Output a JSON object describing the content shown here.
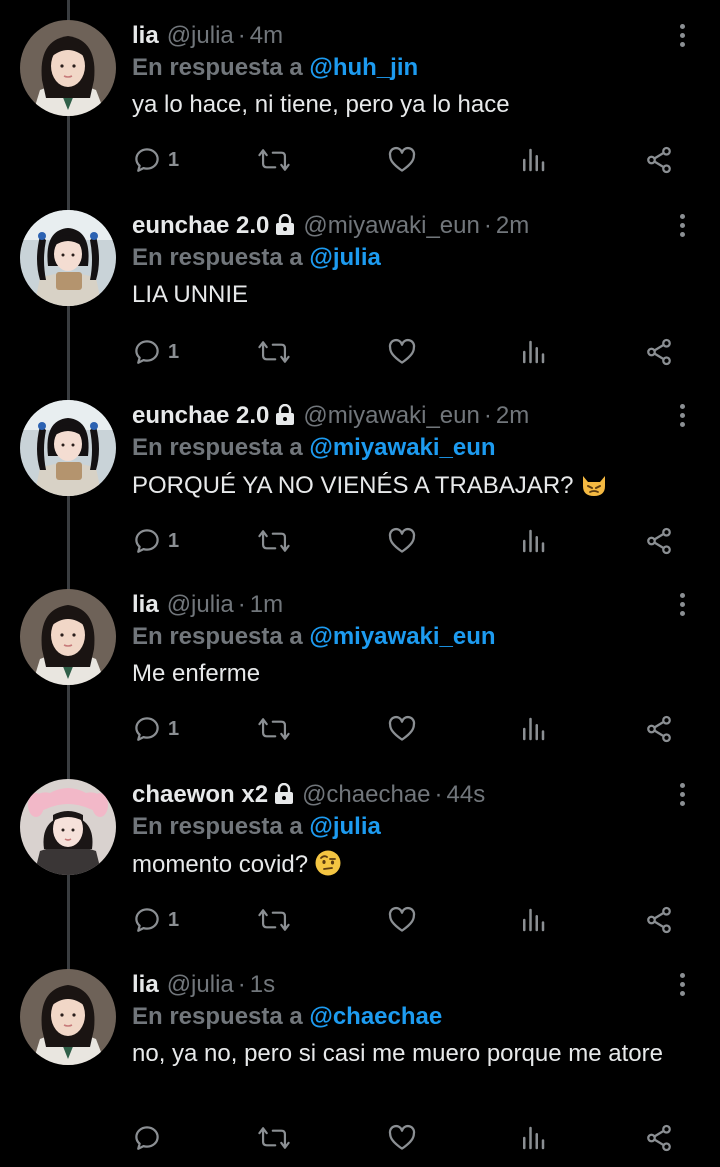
{
  "reply_prefix": "En respuesta a",
  "colors": {
    "background": "#000000",
    "text": "#e7e9ea",
    "muted": "#71767b",
    "mention": "#1d9bf0",
    "thread_line": "#3a3d40"
  },
  "tweets": [
    {
      "name": "lia",
      "handle": "@julia",
      "time": "4m",
      "locked": false,
      "reply_to": "@huh_jin",
      "text": "ya lo hace, ni tiene, pero ya lo hace",
      "emoji": "",
      "reply_count": "1",
      "avatar": "woman-in-school-uniform"
    },
    {
      "name": "eunchae 2.0",
      "handle": "@miyawaki_eun",
      "time": "2m",
      "locked": true,
      "reply_to": "@julia",
      "text": "LIA UNNIE",
      "emoji": "",
      "reply_count": "1",
      "avatar": "girl-with-pigtails-holding-cake"
    },
    {
      "name": "eunchae 2.0",
      "handle": "@miyawaki_eun",
      "time": "2m",
      "locked": true,
      "reply_to": "@miyawaki_eun",
      "text": "PORQUÉ YA NO VIENÉS A TRABAJAR?",
      "emoji": "pouting-cat",
      "reply_count": "1",
      "avatar": "girl-with-pigtails-holding-cake"
    },
    {
      "name": "lia",
      "handle": "@julia",
      "time": "1m",
      "locked": false,
      "reply_to": "@miyawaki_eun",
      "text": "Me enferme",
      "emoji": "",
      "reply_count": "1",
      "avatar": "woman-in-school-uniform"
    },
    {
      "name": "chaewon x2",
      "handle": "@chaechae",
      "time": "44s",
      "locked": true,
      "reply_to": "@julia",
      "text": "momento covid?",
      "emoji": "face-with-raised-eyebrow",
      "reply_count": "1",
      "avatar": "girl-in-pink-bunny-hat"
    },
    {
      "name": "lia",
      "handle": "@julia",
      "time": "1s",
      "locked": false,
      "reply_to": "@chaechae",
      "text": "no, ya no, pero si casi me muero porque me atore",
      "emoji": "",
      "reply_count": "",
      "avatar": "woman-in-school-uniform"
    }
  ]
}
